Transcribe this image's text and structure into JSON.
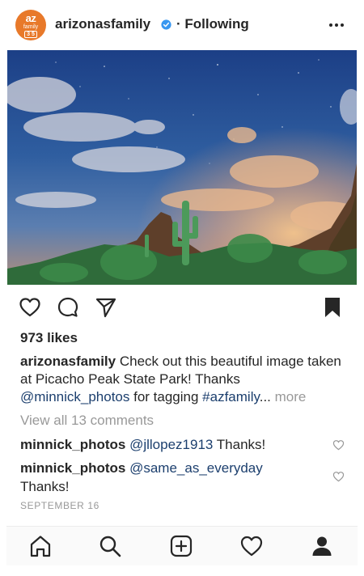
{
  "post_header": {
    "avatar_line1": "az",
    "avatar_line2": "family",
    "avatar_line3": "3 5",
    "username": "arizonasfamily",
    "separator": "·",
    "following_label": "Following"
  },
  "icons": {
    "more": "more-icon",
    "verified": "verified-badge-icon",
    "like": "heart-icon",
    "comment": "comment-icon",
    "share": "paper-plane-icon",
    "save": "bookmark-filled-icon",
    "home": "home-icon",
    "search": "search-icon",
    "new_post": "plus-square-icon",
    "activity": "heart-icon",
    "profile": "person-filled-icon"
  },
  "post": {
    "likes": "973 likes",
    "caption_user": "arizonasfamily",
    "caption_text_1": " Check out this beautiful image taken at Picacho Peak State Park! Thanks ",
    "caption_mention": "@minnick_photos",
    "caption_text_2": " for tagging ",
    "caption_hashtag": "#azfamily",
    "caption_ellipsis": "...",
    "caption_more": " more",
    "view_all_comments": "View all 13 comments",
    "comments": [
      {
        "user": "minnick_photos",
        "mention": "@jllopez1913",
        "text": " Thanks!"
      },
      {
        "user": "minnick_photos",
        "mention": "@same_as_everyday",
        "text": "Thanks!"
      }
    ],
    "date": "SEPTEMBER 16"
  },
  "colors": {
    "avatar_bg": "#e8792a",
    "link": "#1c3f6e",
    "verified": "#3897f0",
    "muted": "#999999"
  }
}
